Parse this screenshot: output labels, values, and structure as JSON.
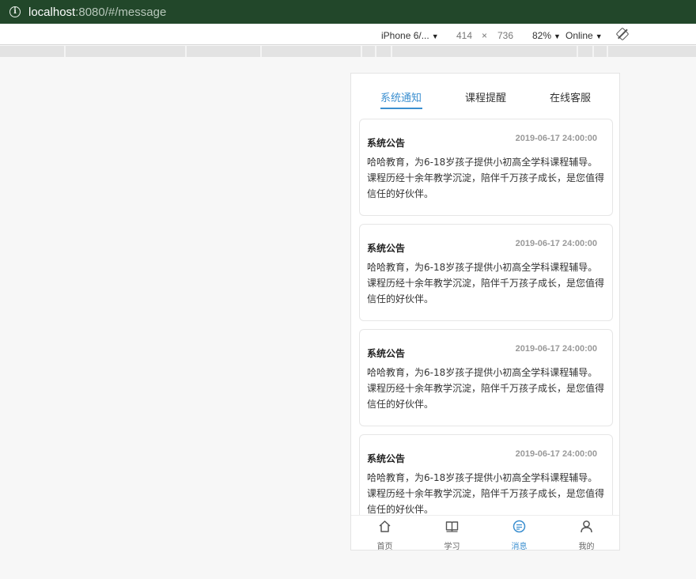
{
  "browser": {
    "url_host": "localhost",
    "url_rest": ":8080/#/message"
  },
  "device_toolbar": {
    "device": "iPhone 6/...",
    "width": "414",
    "times": "×",
    "height": "736",
    "zoom": "82%",
    "network": "Online"
  },
  "tabs": [
    {
      "label": "系统通知",
      "active": true
    },
    {
      "label": "课程提醒",
      "active": false
    },
    {
      "label": "在线客服",
      "active": false
    }
  ],
  "cards": [
    {
      "title": "系统公告",
      "time": "2019-06-17 24:00:00",
      "body": "哈哈教育，为6-18岁孩子提供小初高全学科课程辅导。课程历经十余年教学沉淀，陪伴千万孩子成长，是您值得信任的好伙伴。"
    },
    {
      "title": "系统公告",
      "time": "2019-06-17 24:00:00",
      "body": "哈哈教育，为6-18岁孩子提供小初高全学科课程辅导。课程历经十余年教学沉淀，陪伴千万孩子成长，是您值得信任的好伙伴。"
    },
    {
      "title": "系统公告",
      "time": "2019-06-17 24:00:00",
      "body": "哈哈教育，为6-18岁孩子提供小初高全学科课程辅导。课程历经十余年教学沉淀，陪伴千万孩子成长，是您值得信任的好伙伴。"
    },
    {
      "title": "系统公告",
      "time": "2019-06-17 24:00:00",
      "body": "哈哈教育，为6-18岁孩子提供小初高全学科课程辅导。课程历经十余年教学沉淀，陪伴千万孩子成长，是您值得信任的好伙伴。"
    }
  ],
  "bottom_nav": [
    {
      "label": "首页",
      "icon": "home-icon",
      "active": false
    },
    {
      "label": "学习",
      "icon": "book-icon",
      "active": false
    },
    {
      "label": "消息",
      "icon": "message-icon",
      "active": true
    },
    {
      "label": "我的",
      "icon": "user-icon",
      "active": false
    }
  ],
  "colors": {
    "accent": "#3b8fd0",
    "urlbar": "#22472a"
  }
}
